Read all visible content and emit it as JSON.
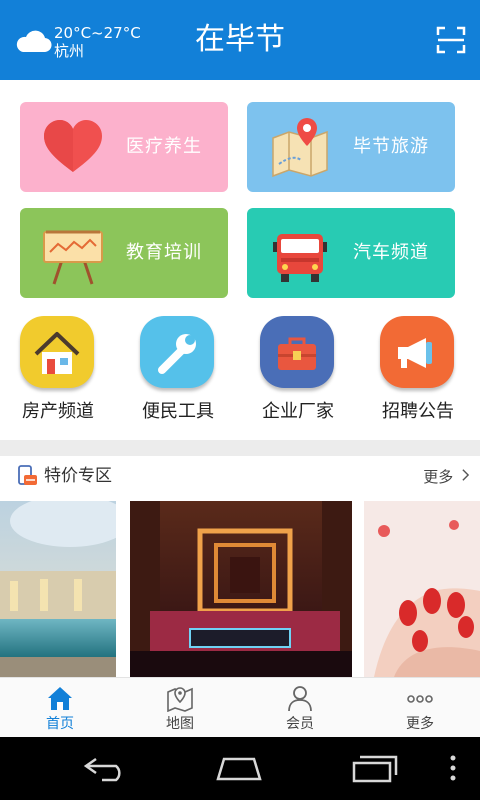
{
  "header": {
    "weather": {
      "icon": "cloud-icon",
      "temperature": "20°C~27°C",
      "city": "杭州"
    },
    "title": "在毕节",
    "scan_icon": "scan-icon",
    "color": "#1280d8"
  },
  "tiles": [
    {
      "label": "医疗养生",
      "icon": "heart-icon",
      "color": "#fcb1cc"
    },
    {
      "label": "毕节旅游",
      "icon": "map-pin-icon",
      "color": "#7dc2ee"
    },
    {
      "label": "教育培训",
      "icon": "chalkboard-icon",
      "color": "#8cc55a"
    },
    {
      "label": "汽车频道",
      "icon": "truck-icon",
      "color": "#28cbb3"
    }
  ],
  "shortcuts": [
    {
      "label": "房产频道",
      "icon": "house-icon",
      "color": "#f1cb2d"
    },
    {
      "label": "便民工具",
      "icon": "wrench-icon",
      "color": "#55c1ea"
    },
    {
      "label": "企业厂家",
      "icon": "toolbox-icon",
      "color": "#4a6eb7"
    },
    {
      "label": "招聘公告",
      "icon": "megaphone-icon",
      "color": "#f26a35"
    }
  ],
  "special": {
    "title": "特价专区",
    "more": "更多",
    "icon": "tag-icon",
    "photos": [
      "pool-photo",
      "ktv-room-photo",
      "nails-photo"
    ]
  },
  "bottom_nav": [
    {
      "label": "首页",
      "icon": "home-icon",
      "active": true
    },
    {
      "label": "地图",
      "icon": "map-icon",
      "active": false
    },
    {
      "label": "会员",
      "icon": "user-icon",
      "active": false
    },
    {
      "label": "更多",
      "icon": "more-dots-icon",
      "active": false
    }
  ],
  "system_bar": [
    "back-icon",
    "home-key-icon",
    "recents-icon",
    "overflow-icon"
  ]
}
